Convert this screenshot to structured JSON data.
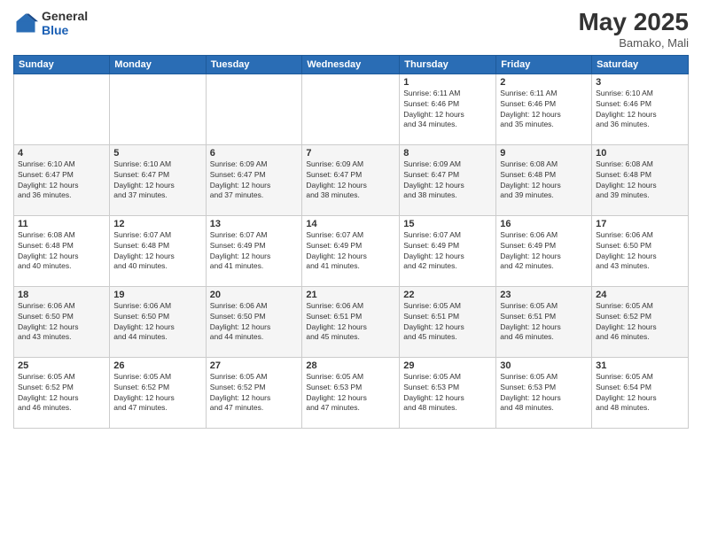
{
  "header": {
    "logo_general": "General",
    "logo_blue": "Blue",
    "month_year": "May 2025",
    "location": "Bamako, Mali"
  },
  "weekdays": [
    "Sunday",
    "Monday",
    "Tuesday",
    "Wednesday",
    "Thursday",
    "Friday",
    "Saturday"
  ],
  "weeks": [
    [
      {
        "day": "",
        "info": ""
      },
      {
        "day": "",
        "info": ""
      },
      {
        "day": "",
        "info": ""
      },
      {
        "day": "",
        "info": ""
      },
      {
        "day": "1",
        "info": "Sunrise: 6:11 AM\nSunset: 6:46 PM\nDaylight: 12 hours\nand 34 minutes."
      },
      {
        "day": "2",
        "info": "Sunrise: 6:11 AM\nSunset: 6:46 PM\nDaylight: 12 hours\nand 35 minutes."
      },
      {
        "day": "3",
        "info": "Sunrise: 6:10 AM\nSunset: 6:46 PM\nDaylight: 12 hours\nand 36 minutes."
      }
    ],
    [
      {
        "day": "4",
        "info": "Sunrise: 6:10 AM\nSunset: 6:47 PM\nDaylight: 12 hours\nand 36 minutes."
      },
      {
        "day": "5",
        "info": "Sunrise: 6:10 AM\nSunset: 6:47 PM\nDaylight: 12 hours\nand 37 minutes."
      },
      {
        "day": "6",
        "info": "Sunrise: 6:09 AM\nSunset: 6:47 PM\nDaylight: 12 hours\nand 37 minutes."
      },
      {
        "day": "7",
        "info": "Sunrise: 6:09 AM\nSunset: 6:47 PM\nDaylight: 12 hours\nand 38 minutes."
      },
      {
        "day": "8",
        "info": "Sunrise: 6:09 AM\nSunset: 6:47 PM\nDaylight: 12 hours\nand 38 minutes."
      },
      {
        "day": "9",
        "info": "Sunrise: 6:08 AM\nSunset: 6:48 PM\nDaylight: 12 hours\nand 39 minutes."
      },
      {
        "day": "10",
        "info": "Sunrise: 6:08 AM\nSunset: 6:48 PM\nDaylight: 12 hours\nand 39 minutes."
      }
    ],
    [
      {
        "day": "11",
        "info": "Sunrise: 6:08 AM\nSunset: 6:48 PM\nDaylight: 12 hours\nand 40 minutes."
      },
      {
        "day": "12",
        "info": "Sunrise: 6:07 AM\nSunset: 6:48 PM\nDaylight: 12 hours\nand 40 minutes."
      },
      {
        "day": "13",
        "info": "Sunrise: 6:07 AM\nSunset: 6:49 PM\nDaylight: 12 hours\nand 41 minutes."
      },
      {
        "day": "14",
        "info": "Sunrise: 6:07 AM\nSunset: 6:49 PM\nDaylight: 12 hours\nand 41 minutes."
      },
      {
        "day": "15",
        "info": "Sunrise: 6:07 AM\nSunset: 6:49 PM\nDaylight: 12 hours\nand 42 minutes."
      },
      {
        "day": "16",
        "info": "Sunrise: 6:06 AM\nSunset: 6:49 PM\nDaylight: 12 hours\nand 42 minutes."
      },
      {
        "day": "17",
        "info": "Sunrise: 6:06 AM\nSunset: 6:50 PM\nDaylight: 12 hours\nand 43 minutes."
      }
    ],
    [
      {
        "day": "18",
        "info": "Sunrise: 6:06 AM\nSunset: 6:50 PM\nDaylight: 12 hours\nand 43 minutes."
      },
      {
        "day": "19",
        "info": "Sunrise: 6:06 AM\nSunset: 6:50 PM\nDaylight: 12 hours\nand 44 minutes."
      },
      {
        "day": "20",
        "info": "Sunrise: 6:06 AM\nSunset: 6:50 PM\nDaylight: 12 hours\nand 44 minutes."
      },
      {
        "day": "21",
        "info": "Sunrise: 6:06 AM\nSunset: 6:51 PM\nDaylight: 12 hours\nand 45 minutes."
      },
      {
        "day": "22",
        "info": "Sunrise: 6:05 AM\nSunset: 6:51 PM\nDaylight: 12 hours\nand 45 minutes."
      },
      {
        "day": "23",
        "info": "Sunrise: 6:05 AM\nSunset: 6:51 PM\nDaylight: 12 hours\nand 46 minutes."
      },
      {
        "day": "24",
        "info": "Sunrise: 6:05 AM\nSunset: 6:52 PM\nDaylight: 12 hours\nand 46 minutes."
      }
    ],
    [
      {
        "day": "25",
        "info": "Sunrise: 6:05 AM\nSunset: 6:52 PM\nDaylight: 12 hours\nand 46 minutes."
      },
      {
        "day": "26",
        "info": "Sunrise: 6:05 AM\nSunset: 6:52 PM\nDaylight: 12 hours\nand 47 minutes."
      },
      {
        "day": "27",
        "info": "Sunrise: 6:05 AM\nSunset: 6:52 PM\nDaylight: 12 hours\nand 47 minutes."
      },
      {
        "day": "28",
        "info": "Sunrise: 6:05 AM\nSunset: 6:53 PM\nDaylight: 12 hours\nand 47 minutes."
      },
      {
        "day": "29",
        "info": "Sunrise: 6:05 AM\nSunset: 6:53 PM\nDaylight: 12 hours\nand 48 minutes."
      },
      {
        "day": "30",
        "info": "Sunrise: 6:05 AM\nSunset: 6:53 PM\nDaylight: 12 hours\nand 48 minutes."
      },
      {
        "day": "31",
        "info": "Sunrise: 6:05 AM\nSunset: 6:54 PM\nDaylight: 12 hours\nand 48 minutes."
      }
    ]
  ]
}
